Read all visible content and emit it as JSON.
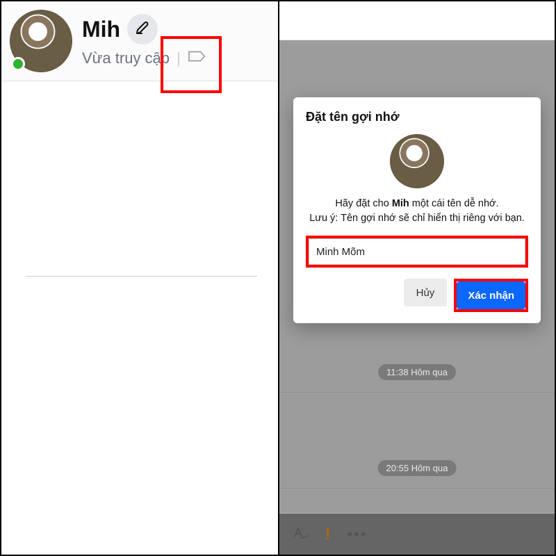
{
  "left": {
    "contact_name": "Mih",
    "status_text": "Vừa truy cập"
  },
  "right": {
    "timestamps": {
      "t1": "11:38 Hôm qua",
      "t2": "20:55 Hôm qua"
    },
    "modal": {
      "title": "Đặt tên gợi nhớ",
      "instruction_prefix": "Hãy đặt cho ",
      "instruction_name": "Mih",
      "instruction_suffix": " một cái tên dễ nhớ.",
      "note": "Lưu ý: Tên gợi nhớ sẽ chỉ hiển thị riêng với bạn.",
      "input_value": "Minh Mõm",
      "cancel_label": "Hủy",
      "confirm_label": "Xác nhận"
    }
  },
  "colors": {
    "highlight": "#ff0000",
    "primary": "#0a67ff",
    "presence": "#2bb32b"
  }
}
